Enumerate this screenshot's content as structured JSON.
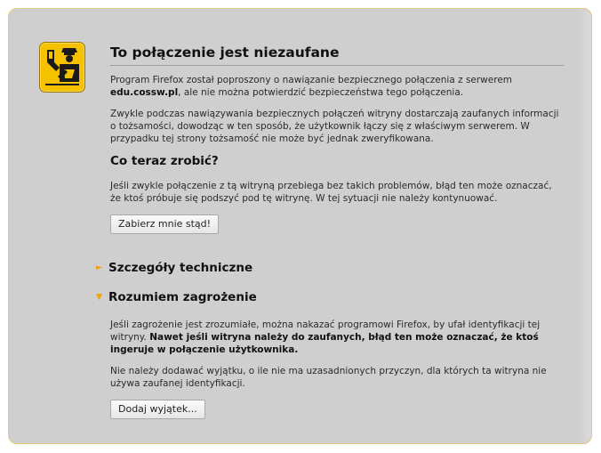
{
  "page": {
    "title": "To połączenie jest niezaufane",
    "intro_prefix": "Program Firefox został poproszony o nawiązanie bezpiecznego połączenia z serwerem ",
    "intro_host": "edu.cossw.pl",
    "intro_suffix": ", ale nie można potwierdzić bezpieczeństwa tego połączenia.",
    "explanation": "Zwykle podczas nawiązywania bezpiecznych połączeń witryny dostarczają zaufanych informacji o tożsamości, dowodząc w ten sposób, że użytkownik łączy się z właściwym serwerem. W przypadku tej strony tożsamość nie może być jednak zweryfikowana.",
    "what_to_do_heading": "Co teraz zrobić?",
    "what_to_do_text": "Jeśli zwykle połączenie z tą witryną przebiega bez takich problemów, błąd ten może oznaczać, że ktoś próbuje się podszyć pod tę witrynę. W tej sytuacji nie należy kontynuować.",
    "get_me_out_button": "Zabierz mnie stąd!",
    "technical_details_label": "Szczegóły techniczne",
    "understand_risks_label": "Rozumiem zagrożenie",
    "risks_text_plain": "Jeśli zagrożenie jest zrozumiałe, można nakazać programowi Firefox, by ufał identyfikacji tej witryny. ",
    "risks_text_bold": "Nawet jeśli witryna należy do zaufanych, błąd ten może oznaczać, że ktoś ingeruje w połączenie użytkownika.",
    "exception_warning": "Nie należy dodawać wyjątku, o ile nie ma uzasadnionych przyczyn, dla których ta witryna nie używa zaufanej identyfikacji.",
    "add_exception_button": "Dodaj wyjątek..."
  },
  "icons": {
    "warning": "police-officer-icon",
    "collapsed_arrow": "triangle-right-icon",
    "expanded_arrow": "triangle-down-icon"
  },
  "colors": {
    "panel_background": "#cfcfcf",
    "panel_border": "#e3c97a",
    "icon_background": "#f6c200",
    "expander_arrow": "#f0a000"
  }
}
